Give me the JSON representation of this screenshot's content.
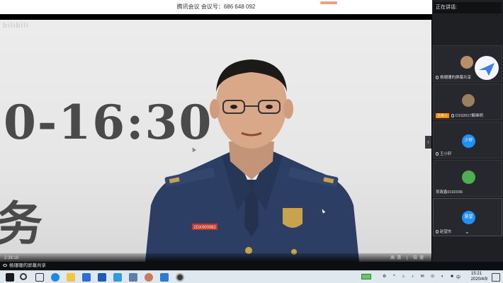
{
  "meeting": {
    "title_bar": "腾讯会议 会议号：686 648 092"
  },
  "video": {
    "watermark": "bilibili",
    "slide_time": "0-16:30",
    "slide_char": "务",
    "badge_code": "2DX000082",
    "time_code": "2:38:18",
    "ctrl_text": "高清 | 倍速"
  },
  "panel": {
    "title": "正在讲话:",
    "participants": [
      {
        "name": "杨珊珊的屏幕共享",
        "avatar": "photo-avatar",
        "host": false
      },
      {
        "name": "D192017解继明",
        "avatar": "photo-avatar",
        "host": true,
        "host_label": "主持人"
      },
      {
        "name": "王小轩",
        "avatar_text": "少轩",
        "host": false
      },
      {
        "name": "吴政鑫0192036",
        "avatar": "frog-avatar",
        "host": false
      },
      {
        "name": "赵望东",
        "avatar_text": "慧望",
        "host": false
      }
    ]
  },
  "share_bar": {
    "label": "杨珊珊的屏幕共享"
  },
  "taskbar": {
    "time": "15:21",
    "date": "2020/4/9",
    "ime": "中"
  },
  "colors": {
    "uniform": "#2c3e63",
    "accent": "#1e90ff",
    "host": "#ff8a00"
  }
}
